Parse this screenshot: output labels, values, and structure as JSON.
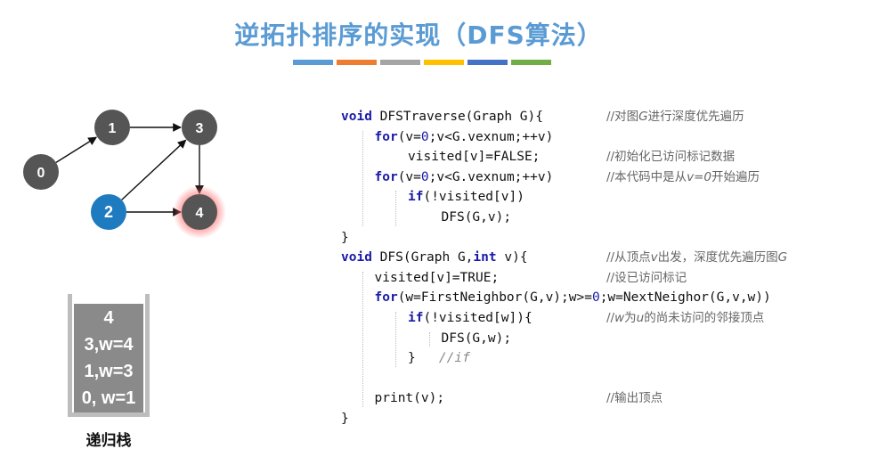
{
  "title": "逆拓扑排序的实现（DFS算法）",
  "colors": {
    "title": "#5a9bd4",
    "bar": [
      "#5b9bd5",
      "#ed7d31",
      "#a5a5a5",
      "#ffc000",
      "#4472c4",
      "#70ad47"
    ],
    "node_gray": "#555555",
    "node_blue": "#1f7bbf",
    "node_glow": "#ff6b6b"
  },
  "graph": {
    "nodes": [
      {
        "id": "0",
        "label": "0",
        "style": "gray"
      },
      {
        "id": "1",
        "label": "1",
        "style": "gray"
      },
      {
        "id": "2",
        "label": "2",
        "style": "blue"
      },
      {
        "id": "3",
        "label": "3",
        "style": "gray"
      },
      {
        "id": "4",
        "label": "4",
        "style": "glow"
      }
    ],
    "edges": [
      [
        "0",
        "1"
      ],
      [
        "1",
        "3"
      ],
      [
        "2",
        "3"
      ],
      [
        "2",
        "4"
      ],
      [
        "3",
        "4"
      ]
    ]
  },
  "stack": {
    "items": [
      "4",
      "3,w=4",
      "1,w=3",
      "0, w=1"
    ],
    "label": "递归栈"
  },
  "code": {
    "lines": [
      {
        "indent": 0,
        "parts": [
          [
            "kw",
            "void"
          ],
          [
            "t",
            " DFSTraverse(Graph G){"
          ]
        ],
        "comment": [
          [
            "t",
            "//对图"
          ],
          [
            "i",
            "G"
          ],
          [
            "t",
            "进行深度优先遍历"
          ]
        ]
      },
      {
        "indent": 1,
        "parts": [
          [
            "kw",
            "for"
          ],
          [
            "t",
            "(v="
          ],
          [
            "num",
            "0"
          ],
          [
            "t",
            ";v<G.vexnum;++v)"
          ]
        ],
        "comment": []
      },
      {
        "indent": 2,
        "parts": [
          [
            "t",
            "visited[v]=FALSE;"
          ]
        ],
        "comment": [
          [
            "t",
            "//初始化已访问标记数据"
          ]
        ]
      },
      {
        "indent": 1,
        "parts": [
          [
            "kw",
            "for"
          ],
          [
            "t",
            "(v="
          ],
          [
            "num",
            "0"
          ],
          [
            "t",
            ";v<G.vexnum;++v)"
          ]
        ],
        "comment": [
          [
            "t",
            "//本代码中是从"
          ],
          [
            "i",
            "v=0"
          ],
          [
            "t",
            "开始遍历"
          ]
        ]
      },
      {
        "indent": 2,
        "parts": [
          [
            "kw",
            "if"
          ],
          [
            "t",
            "(!visited[v])"
          ]
        ],
        "comment": []
      },
      {
        "indent": 3,
        "parts": [
          [
            "t",
            "DFS(G,v);"
          ]
        ],
        "comment": []
      },
      {
        "indent": 0,
        "parts": [
          [
            "t",
            "}"
          ]
        ],
        "comment": []
      },
      {
        "indent": 0,
        "parts": [
          [
            "kw",
            "void"
          ],
          [
            "t",
            " DFS(Graph G,"
          ],
          [
            "kw",
            "int"
          ],
          [
            "t",
            " v){"
          ]
        ],
        "comment": [
          [
            "t",
            "//从顶点"
          ],
          [
            "i",
            "v"
          ],
          [
            "t",
            "出发，深度优先遍历图"
          ],
          [
            "i",
            "G"
          ]
        ]
      },
      {
        "indent": 1,
        "parts": [
          [
            "t",
            "visited[v]=TRUE;"
          ]
        ],
        "comment": [
          [
            "t",
            "//设已访问标记"
          ]
        ]
      },
      {
        "indent": 1,
        "parts": [
          [
            "kw",
            "for"
          ],
          [
            "t",
            "(w=FirstNeighbor(G,v);w>="
          ],
          [
            "num",
            "0"
          ],
          [
            "t",
            ";w=NextNeighor(G,v,w))"
          ]
        ],
        "comment": []
      },
      {
        "indent": 2,
        "parts": [
          [
            "kw",
            "if"
          ],
          [
            "t",
            "(!visited[w]){"
          ]
        ],
        "comment": [
          [
            "t",
            "//"
          ],
          [
            "i",
            "w"
          ],
          [
            "t",
            "为"
          ],
          [
            "i",
            "u"
          ],
          [
            "t",
            "的尚未访问的邻接顶点"
          ]
        ]
      },
      {
        "indent": 3,
        "parts": [
          [
            "t",
            "DFS(G,w);"
          ]
        ],
        "comment": []
      },
      {
        "indent": 2,
        "parts": [
          [
            "t",
            "}   "
          ],
          [
            "cmi",
            "//if"
          ]
        ],
        "comment": []
      },
      {
        "indent": 0,
        "parts": [
          [
            "t",
            ""
          ]
        ],
        "comment": []
      },
      {
        "indent": 1,
        "parts": [
          [
            "t",
            "print(v);"
          ]
        ],
        "comment": [
          [
            "t",
            "//输出顶点"
          ]
        ]
      },
      {
        "indent": 0,
        "parts": [
          [
            "t",
            "}"
          ]
        ],
        "comment": []
      }
    ]
  }
}
